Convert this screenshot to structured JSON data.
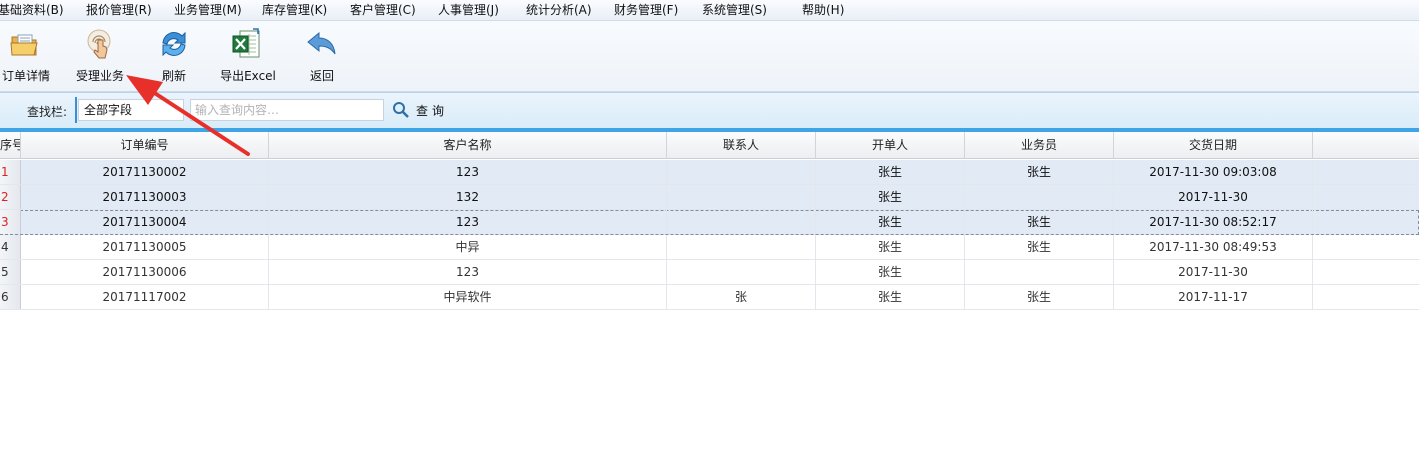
{
  "menu": [
    "基础资料(B)",
    "报价管理(R)",
    "业务管理(M)",
    "库存管理(K)",
    "客户管理(C)",
    "人事管理(J)",
    "统计分析(A)",
    "财务管理(F)",
    "系统管理(S)",
    "帮助(H)"
  ],
  "toolbar": {
    "order_detail": "订单详情",
    "accept_business": "受理业务",
    "refresh": "刷新",
    "export_excel": "导出Excel",
    "back": "返回"
  },
  "search": {
    "label": "查找栏:",
    "field": "全部字段",
    "placeholder": "输入查询内容…",
    "button": "查询"
  },
  "table": {
    "columns": [
      "序号",
      "订单编号",
      "客户名称",
      "联系人",
      "开单人",
      "业务员",
      "交货日期"
    ],
    "rows": [
      {
        "no": "1",
        "order": "20171130002",
        "customer": "123",
        "contact": "",
        "creator": "张生",
        "salesman": "张生",
        "date": "2017-11-30 09:03:08"
      },
      {
        "no": "2",
        "order": "20171130003",
        "customer": "132",
        "contact": "",
        "creator": "张生",
        "salesman": "",
        "date": "2017-11-30"
      },
      {
        "no": "3",
        "order": "20171130004",
        "customer": "123",
        "contact": "",
        "creator": "张生",
        "salesman": "张生",
        "date": "2017-11-30 08:52:17"
      },
      {
        "no": "4",
        "order": "20171130005",
        "customer": "中异",
        "contact": "",
        "creator": "张生",
        "salesman": "张生",
        "date": "2017-11-30 08:49:53"
      },
      {
        "no": "5",
        "order": "20171130006",
        "customer": "123",
        "contact": "",
        "creator": "张生",
        "salesman": "",
        "date": "2017-11-30"
      },
      {
        "no": "6",
        "order": "20171117002",
        "customer": "中异软件",
        "contact": "张",
        "creator": "张生",
        "salesman": "张生",
        "date": "2017-11-17"
      }
    ]
  },
  "colors": {
    "accent_blue": "#3ea4e6",
    "selected_row": "#e2ebf5",
    "selected_rownum": "#d22222",
    "arrow_red": "#e8302a"
  }
}
